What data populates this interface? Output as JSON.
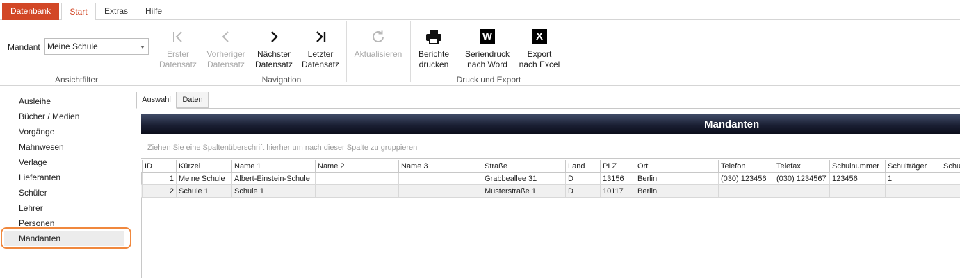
{
  "ribbon_tabs": {
    "file": "Datenbank",
    "start": "Start",
    "extras": "Extras",
    "help": "Hilfe"
  },
  "view_filter": {
    "label": "Mandant",
    "selected": "Meine Schule",
    "group_label": "Ansichtfilter"
  },
  "navigation": {
    "group_label": "Navigation",
    "first": [
      "Erster",
      "Datensatz"
    ],
    "previous": [
      "Vorheriger",
      "Datensatz"
    ],
    "next": [
      "Nächster",
      "Datensatz"
    ],
    "last": [
      "Letzter",
      "Datensatz"
    ],
    "refresh": [
      "Aktualisieren"
    ]
  },
  "print_export": {
    "group_label": "Druck und Export",
    "print_reports": [
      "Berichte",
      "drucken"
    ],
    "mailmerge_word": [
      "Seriendruck",
      "nach Word"
    ],
    "export_excel": [
      "Export",
      "nach Excel"
    ],
    "word_letter": "W",
    "excel_letter": "X"
  },
  "sidebar": {
    "items": [
      {
        "label": "Ausleihe"
      },
      {
        "label": "Bücher / Medien"
      },
      {
        "label": "Vorgänge"
      },
      {
        "label": "Mahnwesen"
      },
      {
        "label": "Verlage"
      },
      {
        "label": "Lieferanten"
      },
      {
        "label": "Schüler"
      },
      {
        "label": "Lehrer"
      },
      {
        "label": "Personen"
      },
      {
        "label": "Mandanten"
      }
    ],
    "selected": "Mandanten"
  },
  "content_tabs": {
    "selection": "Auswahl",
    "data": "Daten"
  },
  "main": {
    "title": "Mandanten",
    "group_hint": "Ziehen Sie eine Spaltenüberschrift hierher um nach dieser Spalte zu gruppieren"
  },
  "table": {
    "columns": [
      "ID",
      "Kürzel",
      "Name 1",
      "Name 2",
      "Name 3",
      "Straße",
      "Land",
      "PLZ",
      "Ort",
      "Telefon",
      "Telefax",
      "Schulnummer",
      "Schulträger",
      "Schul"
    ],
    "rows": [
      [
        "1",
        "Meine Schule",
        "Albert-Einstein-Schule",
        "",
        "",
        "Grabbeallee 31",
        "D",
        "13156",
        "Berlin",
        "(030) 123456",
        "(030) 1234567",
        "123456",
        "1",
        ""
      ],
      [
        "2",
        "Schule 1",
        "Schule 1",
        "",
        "",
        "Musterstraße 1",
        "D",
        "10117",
        "Berlin",
        "",
        "",
        "",
        "",
        ""
      ]
    ]
  },
  "colors": {
    "accent": "#d24726",
    "highlight_outline": "#f0883e",
    "banner_dark": "#0a0c18"
  }
}
